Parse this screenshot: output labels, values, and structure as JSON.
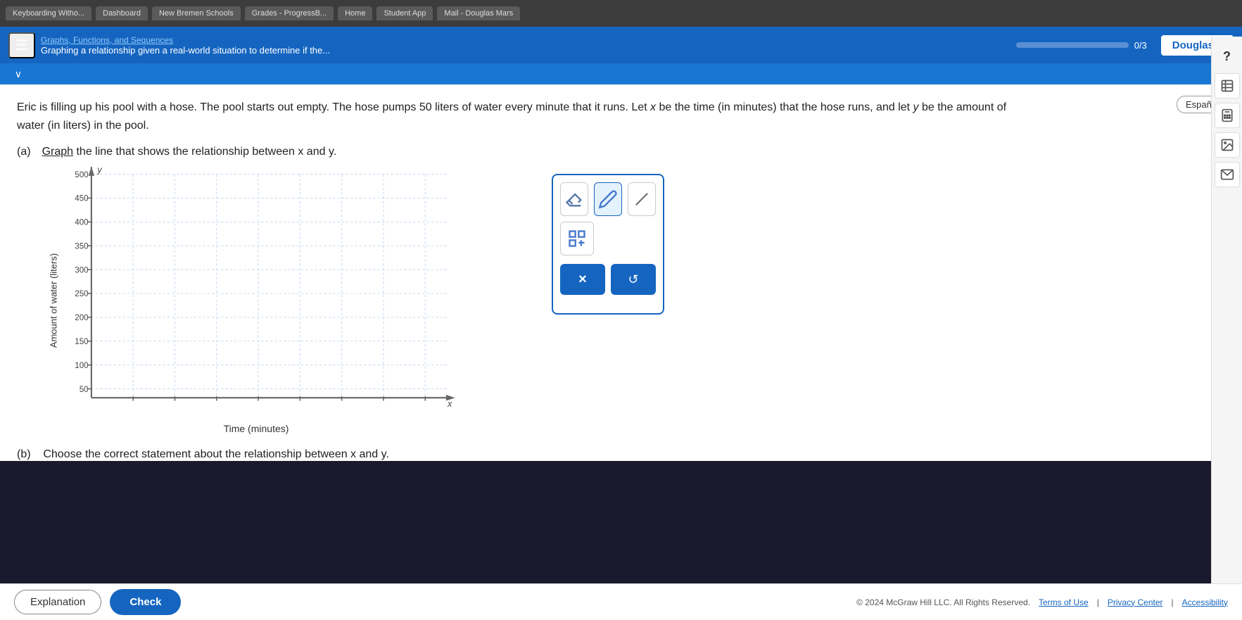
{
  "browser": {
    "tabs": [
      {
        "label": "Keyboarding Witho...",
        "active": false
      },
      {
        "label": "Dashboard",
        "active": false
      },
      {
        "label": "New Bremen Schools",
        "active": false
      },
      {
        "label": "Grades - ProgressB...",
        "active": false
      },
      {
        "label": "Home",
        "active": false
      },
      {
        "label": "Student App",
        "active": false
      },
      {
        "label": "Mail - Douglas Mars",
        "active": false
      }
    ]
  },
  "nav": {
    "breadcrumb_top": "Graphs, Functions, and Sequences",
    "breadcrumb_bottom": "Graphing a relationship given a real-world situation to determine if the...",
    "progress_text": "0/3",
    "progress_percent": 0,
    "user_name": "Douglas"
  },
  "content": {
    "espanol_label": "Español",
    "problem_text": "Eric is filling up his pool with a hose. The pool starts out empty. The hose pumps 50 liters of water every minute that it runs. Let x be the time (in minutes) that the hose runs, and let y be the amount of water (in liters) in the pool.",
    "part_a_label": "(a)",
    "part_a_instruction": "Graph the line that shows the relationship between x and y.",
    "graph": {
      "y_axis_label": "Amount of water (liters)",
      "x_axis_label": "Time (minutes)",
      "y_values": [
        500,
        450,
        400,
        350,
        300,
        250,
        200,
        150,
        100,
        50
      ],
      "x_label": "x",
      "y_label": "y"
    },
    "tools": {
      "eraser_label": "eraser",
      "pencil_label": "pencil",
      "line_label": "line",
      "grid_label": "grid",
      "delete_label": "×",
      "reset_label": "↺"
    },
    "part_b_label": "(b)",
    "part_b_instruction": "Choose the correct statement about the relationship between x and y."
  },
  "footer": {
    "copyright": "© 2024 McGraw Hill LLC. All Rights Reserved.",
    "links": [
      "Terms of Use",
      "Privacy Center",
      "Accessibility"
    ],
    "explanation_label": "Explanation",
    "check_label": "Check"
  },
  "right_panel": {
    "question_mark": "?",
    "icons": [
      "grid-icon",
      "book-icon",
      "image-icon",
      "mail-icon"
    ]
  }
}
